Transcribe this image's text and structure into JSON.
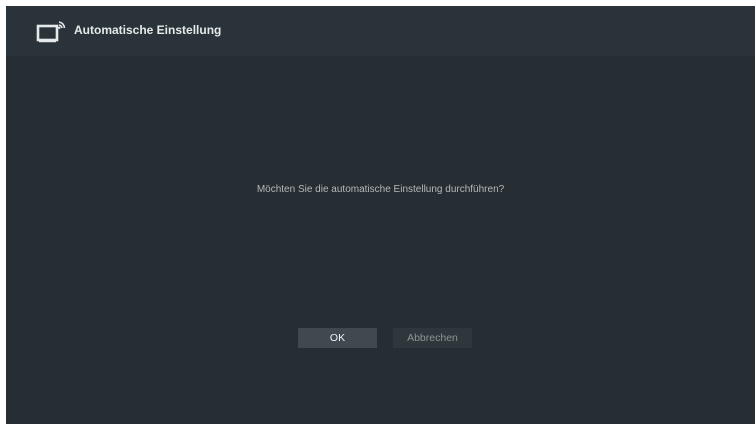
{
  "header": {
    "icon": "tv-antenna-icon",
    "title": "Automatische Einstellung"
  },
  "dialog": {
    "prompt": "Möchten Sie die automatische Einstellung durchführen?",
    "ok_label": "OK",
    "cancel_label": "Abbrechen"
  },
  "colors": {
    "background": "#262e33",
    "header_background": "#293339",
    "focused_button": "#3f494f",
    "unfocused_button": "#2e373c"
  }
}
